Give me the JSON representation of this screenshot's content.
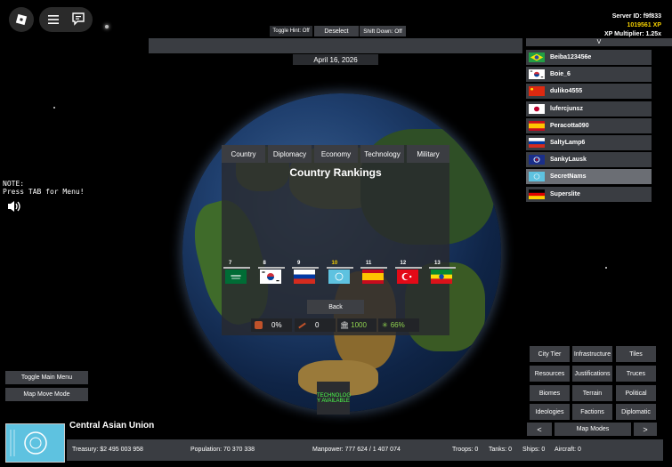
{
  "top_bar": {
    "toggle_hint": "Toggle Hint: Off",
    "deselect": "Deselect",
    "shift_down": "Shift Down: Off",
    "date": "April 16, 2026"
  },
  "server_info": {
    "server_id": "Server ID: f9f833",
    "xp": "1019561 XP",
    "xp_multiplier": "XP Multiplier: 1.25x"
  },
  "player_list": {
    "toggle": "V",
    "players": [
      {
        "name": "Beiba123456e",
        "flag": "brazil"
      },
      {
        "name": "Boie_6",
        "flag": "south-korea"
      },
      {
        "name": "duliko4555",
        "flag": "china"
      },
      {
        "name": "lufercjunsz",
        "flag": "japan"
      },
      {
        "name": "Peracotta090",
        "flag": "spain"
      },
      {
        "name": "SaltyLamp6",
        "flag": "russia"
      },
      {
        "name": "SankyLausk",
        "flag": "union"
      },
      {
        "name": "SecretNams",
        "flag": "central-asian-union"
      },
      {
        "name": "Superslite",
        "flag": "germany"
      }
    ]
  },
  "note": {
    "line1": "NOTE:",
    "line2": "Press TAB for Menu!"
  },
  "rankings": {
    "tabs": [
      "Country",
      "Diplomacy",
      "Economy",
      "Technology",
      "Military"
    ],
    "title": "Country Rankings",
    "entries": [
      {
        "rank": "7",
        "flag": "saudi-arabia",
        "color": "#ffffff"
      },
      {
        "rank": "8",
        "flag": "south-korea",
        "color": "#ffffff"
      },
      {
        "rank": "9",
        "flag": "russia",
        "color": "#ffffff"
      },
      {
        "rank": "10",
        "flag": "central-asian-union",
        "color": "#f5d000"
      },
      {
        "rank": "11",
        "flag": "spain",
        "color": "#ffffff"
      },
      {
        "rank": "12",
        "flag": "turkey",
        "color": "#ffffff"
      },
      {
        "rank": "13",
        "flag": "ethiopia",
        "color": "#ffffff"
      }
    ],
    "back": "Back",
    "stats": {
      "stat1": "0%",
      "stat2": "0",
      "stat3": "1000",
      "stat4": "66%"
    }
  },
  "left_menu": {
    "toggle_main_menu": "Toggle Main Menu",
    "map_move_mode": "Map Move Mode"
  },
  "tech_notice": {
    "line1": "TECHNOLOG",
    "line2": "Y AVAILABLE"
  },
  "right_menu": {
    "buttons": [
      "City Tier",
      "Infrastructure",
      "Tiles",
      "Resources",
      "Justifications",
      "Truces",
      "Biomes",
      "Terrain",
      "Political",
      "Ideologies",
      "Factions",
      "Diplomatic"
    ],
    "prev": "<",
    "map_modes": "Map Modes",
    "next": ">"
  },
  "country": {
    "name": "Central Asian Union",
    "treasury": "Treasury:  $2 495 003 958",
    "population": "Population: 70 370 338",
    "manpower": "Manpower:  777 624  /  1 407 074",
    "troops": "Troops: 0",
    "tanks": "Tanks: 0",
    "ships": "Ships: 0",
    "aircraft": "Aircraft: 0"
  },
  "colors": {
    "accent_gold": "#f5d000",
    "green_stat": "#8fd14f",
    "tech_green": "#4cff4c"
  }
}
